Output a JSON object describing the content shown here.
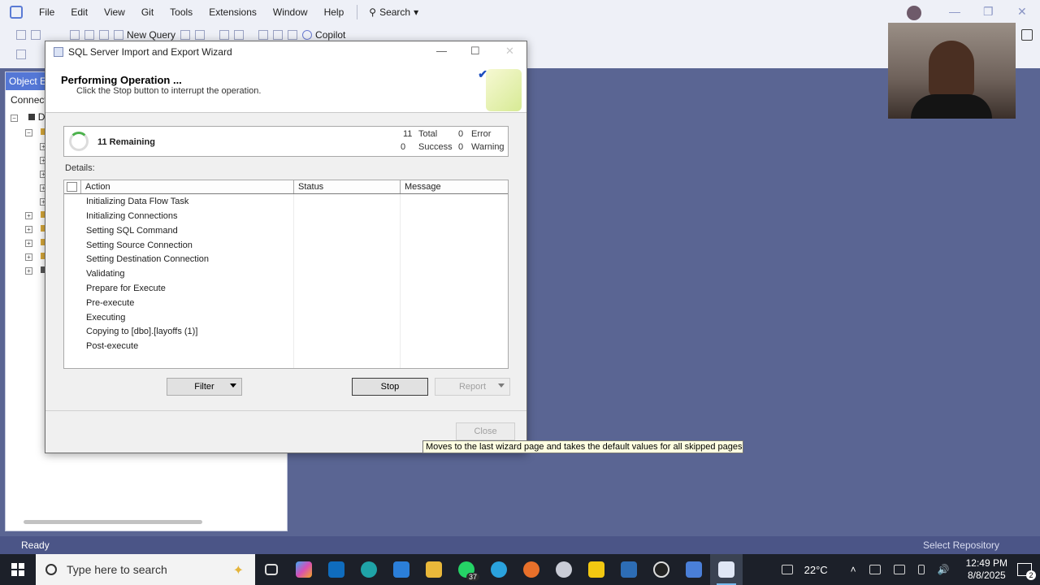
{
  "menu": {
    "items": [
      "File",
      "Edit",
      "View",
      "Git",
      "Tools",
      "Extensions",
      "Window",
      "Help"
    ],
    "search_label": "Search"
  },
  "toolbar": {
    "new_query_label": "New Query",
    "copilot_label": "Copilot"
  },
  "explorer": {
    "tab_label": "Object Ex",
    "connect_label": "Connect",
    "root_label": "D"
  },
  "dialog": {
    "title": "SQL Server Import and Export Wizard",
    "header_title": "Performing Operation ...",
    "header_subtitle": "Click the Stop button to interrupt the operation.",
    "summary": {
      "remaining_label": "11 Remaining",
      "total_count": "11",
      "total_label": "Total",
      "error_count": "0",
      "error_label": "Error",
      "success_count": "0",
      "success_label": "Success",
      "warning_count": "0",
      "warning_label": "Warning"
    },
    "details_label": "Details:",
    "grid": {
      "columns": [
        "Action",
        "Status",
        "Message"
      ],
      "rows": [
        "Initializing Data Flow Task",
        "Initializing Connections",
        "Setting SQL Command",
        "Setting Source Connection",
        "Setting Destination Connection",
        "Validating",
        "Prepare for Execute",
        "Pre-execute",
        "Executing",
        "Copying to [dbo].[layoffs (1)]",
        "Post-execute"
      ]
    },
    "buttons": {
      "filter": "Filter",
      "stop": "Stop",
      "report": "Report",
      "close": "Close"
    }
  },
  "tooltip": "Moves to the last wizard page and takes the default values for all skipped pages",
  "statusbar": {
    "status": "Ready",
    "repo": "Select Repository"
  },
  "taskbar": {
    "search_placeholder": "Type here to search",
    "whatsapp_badge": "37",
    "temperature": "22°C",
    "time": "12:49 PM",
    "date": "8/8/2025",
    "notification_count": "2"
  },
  "colors": {
    "desktop": "#5a6593",
    "status_bar": "#4b5587",
    "taskbar": "#1c2029",
    "tooltip": "#ffffe1"
  }
}
